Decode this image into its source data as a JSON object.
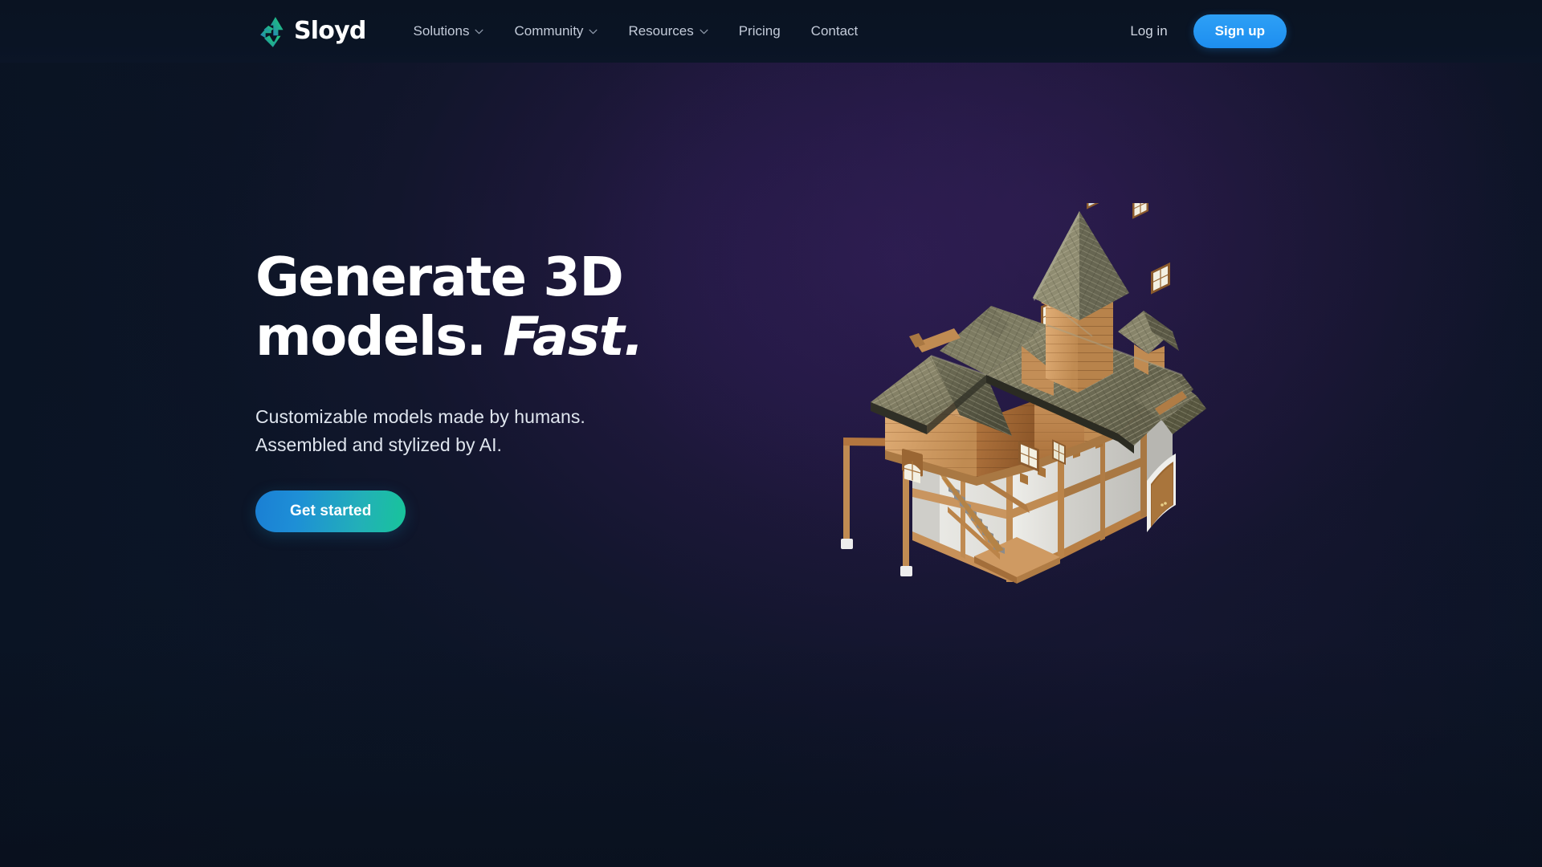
{
  "brand": {
    "name": "Sloyd",
    "logo_icon": "sloyd-recycle-triangle-logo",
    "logo_gradient_start": "#2b7fc4",
    "logo_gradient_end": "#1fd17e"
  },
  "header": {
    "nav_items": [
      {
        "label": "Solutions",
        "has_dropdown": true,
        "icon": "chevron-down-icon"
      },
      {
        "label": "Community",
        "has_dropdown": true,
        "icon": "chevron-down-icon"
      },
      {
        "label": "Resources",
        "has_dropdown": true,
        "icon": "chevron-down-icon"
      },
      {
        "label": "Pricing",
        "has_dropdown": false,
        "icon": ""
      },
      {
        "label": "Contact",
        "has_dropdown": false,
        "icon": ""
      }
    ],
    "login_label": "Log in",
    "signup_label": "Sign up",
    "signup_color": "#2196f3",
    "bar_color": "#0a1424"
  },
  "hero": {
    "headline_part1": "Generate 3D models.",
    "headline_emphasis": "Fast.",
    "subhead_line1": "Customizable models made by humans.",
    "subhead_line2": "Assembled and stylized by AI.",
    "cta_label": "Get started",
    "cta_gradient_start": "#1a7fd4",
    "cta_gradient_end": "#18c49a",
    "background_base": "#0c1628",
    "background_glow": "#2e1e54"
  },
  "illustration": {
    "name": "medieval-wooden-house-3d-model",
    "description": "Stylized Nordic/medieval timber house with shingled gable roof, central tower with tall conical spire, dormer windows, upper wooden storey and lower white plaster half-timbered storey with exterior staircase and arched door.",
    "colors": {
      "wood_light": "#d9a26a",
      "wood_mid": "#b9793f",
      "wood_dark": "#8a5527",
      "roof_light": "#8d8a6e",
      "roof_mid": "#6d6b53",
      "roof_dark": "#4a4a39",
      "plaster": "#e3e2de",
      "plaster_shade": "#c9c8c3",
      "window": "#f2efe2",
      "stone": "#efefef"
    }
  }
}
